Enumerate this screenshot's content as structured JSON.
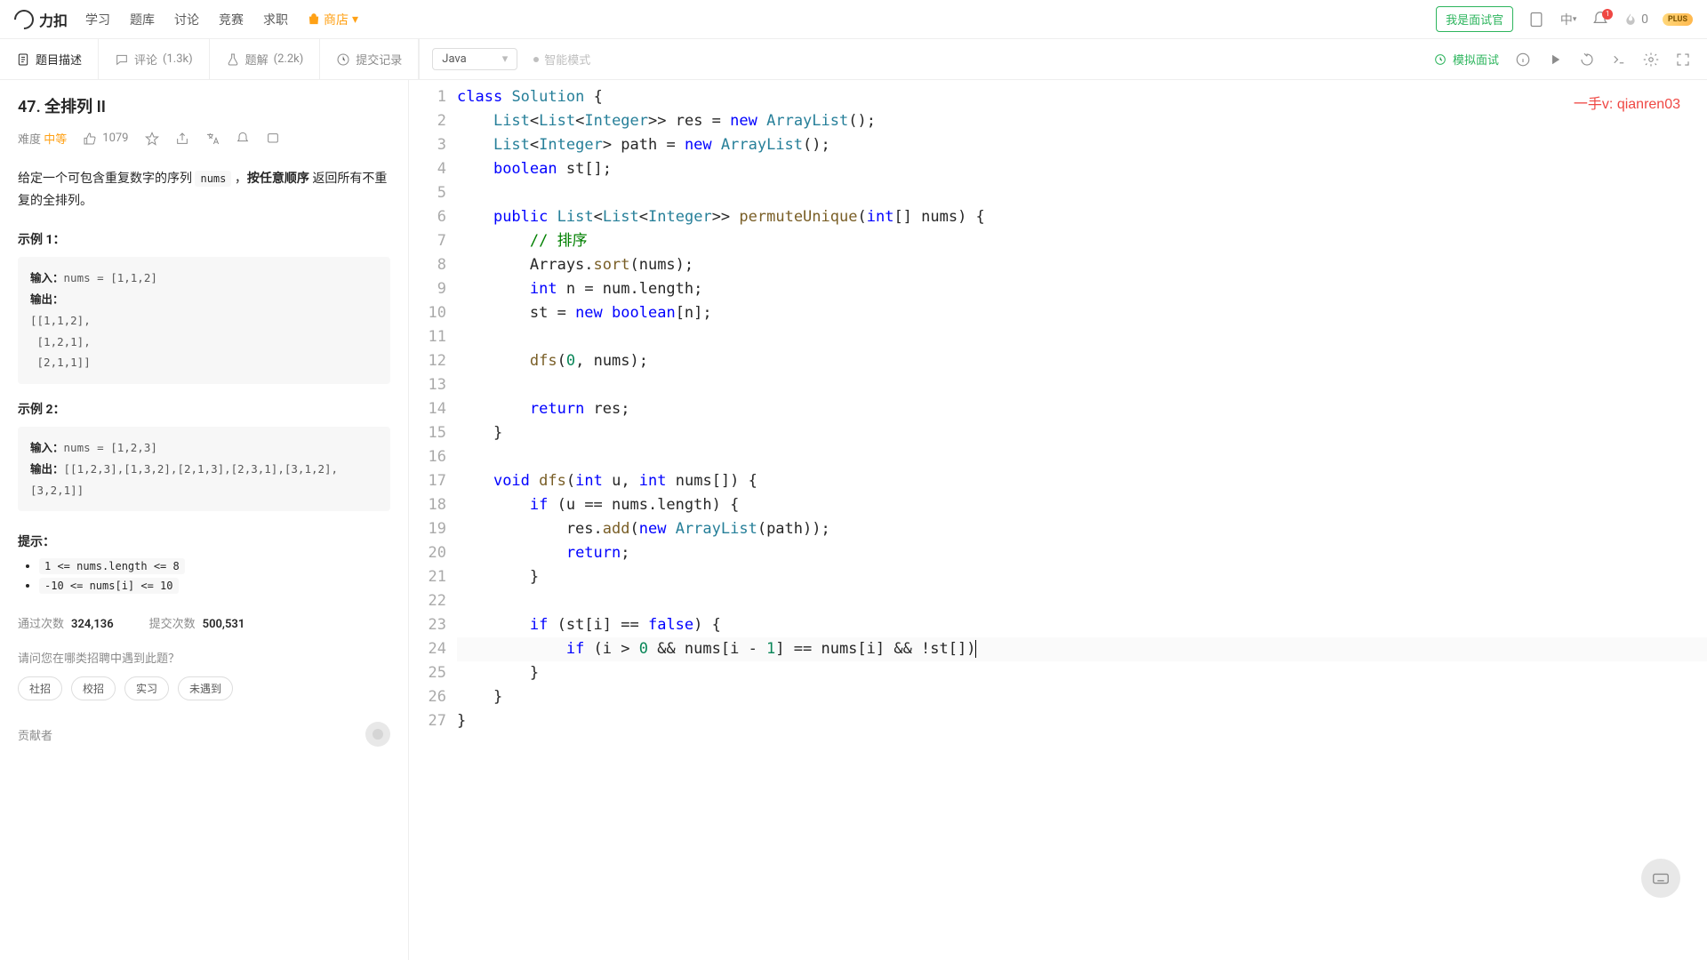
{
  "nav": {
    "logo": "力扣",
    "items": [
      "学习",
      "题库",
      "讨论",
      "竞赛",
      "求职"
    ],
    "shop": "商店",
    "interviewer": "我是面试官",
    "lang_label": "中",
    "notif_count": "1",
    "streak": "0",
    "plus": "PLUS"
  },
  "tabs": {
    "desc": "题目描述",
    "comments_label": "评论",
    "comments_count": "(1.3k)",
    "solutions_label": "题解",
    "solutions_count": "(2.2k)",
    "submissions": "提交记录"
  },
  "editor_bar": {
    "language": "Java",
    "smart_mode": "智能模式",
    "mock": "模拟面试"
  },
  "problem": {
    "title": "47. 全排列 II",
    "difficulty_label": "难度",
    "difficulty": "中等",
    "likes": "1079",
    "desc_pre": "给定一个可包含重复数字的序列 ",
    "desc_code": "nums",
    "desc_mid": " ，",
    "desc_bold": "按任意顺序",
    "desc_post": " 返回所有不重复的全排列。",
    "ex1_title": "示例 1：",
    "ex1_body": "输入：nums = [1,1,2]\n输出：\n[[1,1,2],\n [1,2,1],\n [2,1,1]]",
    "ex2_title": "示例 2：",
    "ex2_body": "输入：nums = [1,2,3]\n输出：[[1,2,3],[1,3,2],[2,1,3],[2,3,1],[3,1,2],[3,2,1]]",
    "hints_title": "提示：",
    "hint1": "1 <= nums.length <= 8",
    "hint2": "-10 <= nums[i] <= 10",
    "accepted_label": "通过次数",
    "accepted": "324,136",
    "submissions_label": "提交次数",
    "submissions": "500,531",
    "company_q": "请问您在哪类招聘中遇到此题？",
    "tags": [
      "社招",
      "校招",
      "实习",
      "未遇到"
    ],
    "contributor": "贡献者"
  },
  "watermark": "一手v: qianren03",
  "code": {
    "lines": [
      {
        "n": 1,
        "tokens": [
          [
            "kw",
            "class"
          ],
          [
            "",
            " "
          ],
          [
            "type",
            "Solution"
          ],
          [
            "",
            " {"
          ]
        ]
      },
      {
        "n": 2,
        "tokens": [
          [
            "",
            "    "
          ],
          [
            "type",
            "List"
          ],
          [
            "",
            "<"
          ],
          [
            "type",
            "List"
          ],
          [
            "",
            "<"
          ],
          [
            "type",
            "Integer"
          ],
          [
            "",
            ">> res = "
          ],
          [
            "kw",
            "new"
          ],
          [
            "",
            " "
          ],
          [
            "type",
            "ArrayList"
          ],
          [
            "",
            "();"
          ]
        ]
      },
      {
        "n": 3,
        "tokens": [
          [
            "",
            "    "
          ],
          [
            "type",
            "List"
          ],
          [
            "",
            "<"
          ],
          [
            "type",
            "Integer"
          ],
          [
            "",
            "> path = "
          ],
          [
            "kw",
            "new"
          ],
          [
            "",
            " "
          ],
          [
            "type",
            "ArrayList"
          ],
          [
            "",
            "();"
          ]
        ]
      },
      {
        "n": 4,
        "tokens": [
          [
            "",
            "    "
          ],
          [
            "kw",
            "boolean"
          ],
          [
            "",
            " st[];"
          ]
        ]
      },
      {
        "n": 5,
        "tokens": [
          [
            "",
            ""
          ]
        ]
      },
      {
        "n": 6,
        "tokens": [
          [
            "",
            "    "
          ],
          [
            "kw",
            "public"
          ],
          [
            "",
            " "
          ],
          [
            "type",
            "List"
          ],
          [
            "",
            "<"
          ],
          [
            "type",
            "List"
          ],
          [
            "",
            "<"
          ],
          [
            "type",
            "Integer"
          ],
          [
            "",
            ">> "
          ],
          [
            "fn",
            "permuteUnique"
          ],
          [
            "",
            "("
          ],
          [
            "kw",
            "int"
          ],
          [
            "",
            "[] nums) {"
          ]
        ]
      },
      {
        "n": 7,
        "tokens": [
          [
            "",
            "        "
          ],
          [
            "cmt",
            "// 排序"
          ]
        ]
      },
      {
        "n": 8,
        "tokens": [
          [
            "",
            "        Arrays."
          ],
          [
            "fn",
            "sort"
          ],
          [
            "",
            "(nums);"
          ]
        ]
      },
      {
        "n": 9,
        "tokens": [
          [
            "",
            "        "
          ],
          [
            "kw",
            "int"
          ],
          [
            "",
            " n = num.length;"
          ]
        ]
      },
      {
        "n": 10,
        "tokens": [
          [
            "",
            "        st = "
          ],
          [
            "kw",
            "new"
          ],
          [
            "",
            " "
          ],
          [
            "kw",
            "boolean"
          ],
          [
            "",
            "[n];"
          ]
        ]
      },
      {
        "n": 11,
        "tokens": [
          [
            "",
            ""
          ]
        ]
      },
      {
        "n": 12,
        "tokens": [
          [
            "",
            "        "
          ],
          [
            "fn",
            "dfs"
          ],
          [
            "",
            "("
          ],
          [
            "num",
            "0"
          ],
          [
            "",
            ", nums);"
          ]
        ]
      },
      {
        "n": 13,
        "tokens": [
          [
            "",
            ""
          ]
        ]
      },
      {
        "n": 14,
        "tokens": [
          [
            "",
            "        "
          ],
          [
            "kw",
            "return"
          ],
          [
            "",
            " res;"
          ]
        ]
      },
      {
        "n": 15,
        "tokens": [
          [
            "",
            "    }"
          ]
        ]
      },
      {
        "n": 16,
        "tokens": [
          [
            "",
            ""
          ]
        ]
      },
      {
        "n": 17,
        "tokens": [
          [
            "",
            "    "
          ],
          [
            "kw",
            "void"
          ],
          [
            "",
            " "
          ],
          [
            "fn",
            "dfs"
          ],
          [
            "",
            "("
          ],
          [
            "kw",
            "int"
          ],
          [
            "",
            " u, "
          ],
          [
            "kw",
            "int"
          ],
          [
            "",
            " nums[]) {"
          ]
        ]
      },
      {
        "n": 18,
        "tokens": [
          [
            "",
            "        "
          ],
          [
            "kw",
            "if"
          ],
          [
            "",
            " (u == nums.length) {"
          ]
        ]
      },
      {
        "n": 19,
        "tokens": [
          [
            "",
            "            res."
          ],
          [
            "fn",
            "add"
          ],
          [
            "",
            "("
          ],
          [
            "kw",
            "new"
          ],
          [
            "",
            " "
          ],
          [
            "type",
            "ArrayList"
          ],
          [
            "",
            "(path));"
          ]
        ]
      },
      {
        "n": 20,
        "tokens": [
          [
            "",
            "            "
          ],
          [
            "kw",
            "return"
          ],
          [
            "",
            ";"
          ]
        ]
      },
      {
        "n": 21,
        "tokens": [
          [
            "",
            "        }"
          ]
        ]
      },
      {
        "n": 22,
        "tokens": [
          [
            "",
            ""
          ]
        ]
      },
      {
        "n": 23,
        "tokens": [
          [
            "",
            "        "
          ],
          [
            "kw",
            "if"
          ],
          [
            "",
            " (st[i] == "
          ],
          [
            "kw",
            "false"
          ],
          [
            "",
            ") {"
          ]
        ]
      },
      {
        "n": 24,
        "tokens": [
          [
            "",
            "            "
          ],
          [
            "kw",
            "if"
          ],
          [
            "",
            " (i > "
          ],
          [
            "num",
            "0"
          ],
          [
            "",
            " && nums[i - "
          ],
          [
            "num",
            "1"
          ],
          [
            "",
            "] == nums[i] && !st[])"
          ]
        ],
        "cursor": true
      },
      {
        "n": 25,
        "tokens": [
          [
            "",
            "        }"
          ]
        ]
      },
      {
        "n": 26,
        "tokens": [
          [
            "",
            "    }"
          ]
        ]
      },
      {
        "n": 27,
        "tokens": [
          [
            "",
            "}"
          ]
        ]
      }
    ]
  }
}
